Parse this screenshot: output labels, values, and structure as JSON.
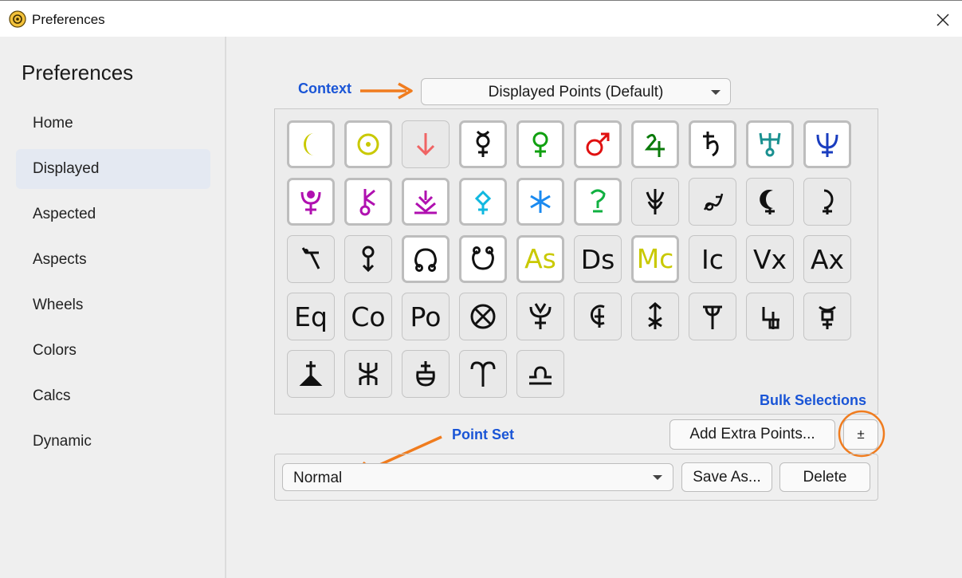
{
  "window": {
    "title": "Preferences"
  },
  "sidebar": {
    "title": "Preferences",
    "items": [
      {
        "label": "Home",
        "active": false
      },
      {
        "label": "Displayed",
        "active": true
      },
      {
        "label": "Aspected",
        "active": false
      },
      {
        "label": "Aspects",
        "active": false
      },
      {
        "label": "Wheels",
        "active": false
      },
      {
        "label": "Colors",
        "active": false
      },
      {
        "label": "Calcs",
        "active": false
      },
      {
        "label": "Dynamic",
        "active": false
      }
    ]
  },
  "annotations": {
    "context": "Context",
    "bulk_selections": "Bulk Selections",
    "point_set": "Point Set"
  },
  "context_select": {
    "value": "Displayed Points (Default)"
  },
  "symbols": [
    {
      "name": "moon",
      "selected": true,
      "color": "#c9c900"
    },
    {
      "name": "sun",
      "selected": true,
      "color": "#c9c900"
    },
    {
      "name": "down-arrow",
      "selected": false,
      "color": "#f06464"
    },
    {
      "name": "mercury",
      "selected": true,
      "color": "#111111"
    },
    {
      "name": "venus",
      "selected": true,
      "color": "#10a010"
    },
    {
      "name": "mars",
      "selected": true,
      "color": "#e01010"
    },
    {
      "name": "jupiter",
      "selected": true,
      "color": "#0a7a0a"
    },
    {
      "name": "saturn",
      "selected": true,
      "color": "#111111"
    },
    {
      "name": "uranus",
      "selected": true,
      "color": "#1a9090"
    },
    {
      "name": "neptune",
      "selected": true,
      "color": "#1a3dbf"
    },
    {
      "name": "pluto",
      "selected": true,
      "color": "#b010b0"
    },
    {
      "name": "chiron",
      "selected": true,
      "color": "#b010b0"
    },
    {
      "name": "pluto-alt",
      "selected": true,
      "color": "#b010b0"
    },
    {
      "name": "pallas",
      "selected": true,
      "color": "#10b8e0"
    },
    {
      "name": "juno",
      "selected": true,
      "color": "#1a8af0"
    },
    {
      "name": "vesta",
      "selected": true,
      "color": "#10b040"
    },
    {
      "name": "ceres",
      "selected": false,
      "color": "#111111"
    },
    {
      "name": "pholus",
      "selected": false,
      "color": "#111111"
    },
    {
      "name": "black-moon",
      "selected": false,
      "color": "#111111"
    },
    {
      "name": "lilith",
      "selected": false,
      "color": "#111111"
    },
    {
      "name": "fortune",
      "selected": false,
      "color": "#111111"
    },
    {
      "name": "vertex-point",
      "selected": false,
      "color": "#111111"
    },
    {
      "name": "north-node",
      "selected": true,
      "color": "#111111"
    },
    {
      "name": "south-node",
      "selected": true,
      "color": "#111111"
    },
    {
      "name": "As",
      "selected": true,
      "color": "#c9c900",
      "text": "As"
    },
    {
      "name": "Ds",
      "selected": false,
      "color": "#111111",
      "text": "Ds"
    },
    {
      "name": "Mc",
      "selected": true,
      "color": "#c9c900",
      "text": "Mc"
    },
    {
      "name": "Ic",
      "selected": false,
      "color": "#111111",
      "text": "Ic"
    },
    {
      "name": "Vx",
      "selected": false,
      "color": "#111111",
      "text": "Vx"
    },
    {
      "name": "Ax",
      "selected": false,
      "color": "#111111",
      "text": "Ax"
    },
    {
      "name": "Eq",
      "selected": false,
      "color": "#111111",
      "text": "Eq"
    },
    {
      "name": "Co",
      "selected": false,
      "color": "#111111",
      "text": "Co"
    },
    {
      "name": "Po",
      "selected": false,
      "color": "#111111",
      "text": "Po"
    },
    {
      "name": "part-of-fortune",
      "selected": false,
      "color": "#111111"
    },
    {
      "name": "hades",
      "selected": false,
      "color": "#111111"
    },
    {
      "name": "cupido",
      "selected": false,
      "color": "#111111"
    },
    {
      "name": "kronos",
      "selected": false,
      "color": "#111111"
    },
    {
      "name": "apollon",
      "selected": false,
      "color": "#111111"
    },
    {
      "name": "admetos",
      "selected": false,
      "color": "#111111"
    },
    {
      "name": "vulkanus",
      "selected": false,
      "color": "#111111"
    },
    {
      "name": "poseidon",
      "selected": false,
      "color": "#111111"
    },
    {
      "name": "zeus",
      "selected": false,
      "color": "#111111"
    },
    {
      "name": "transpluto",
      "selected": false,
      "color": "#111111"
    },
    {
      "name": "aries",
      "selected": false,
      "color": "#111111"
    },
    {
      "name": "libra",
      "selected": false,
      "color": "#111111"
    }
  ],
  "buttons": {
    "add_extra": "Add Extra Points...",
    "plus_minus": "±",
    "save_as": "Save As...",
    "delete": "Delete"
  },
  "pointset_select": {
    "value": "Normal"
  },
  "colors": {
    "annotation_blue": "#1a55d6",
    "arrow_orange": "#f07c1e",
    "highlight_bg": "#e4e9f2"
  }
}
